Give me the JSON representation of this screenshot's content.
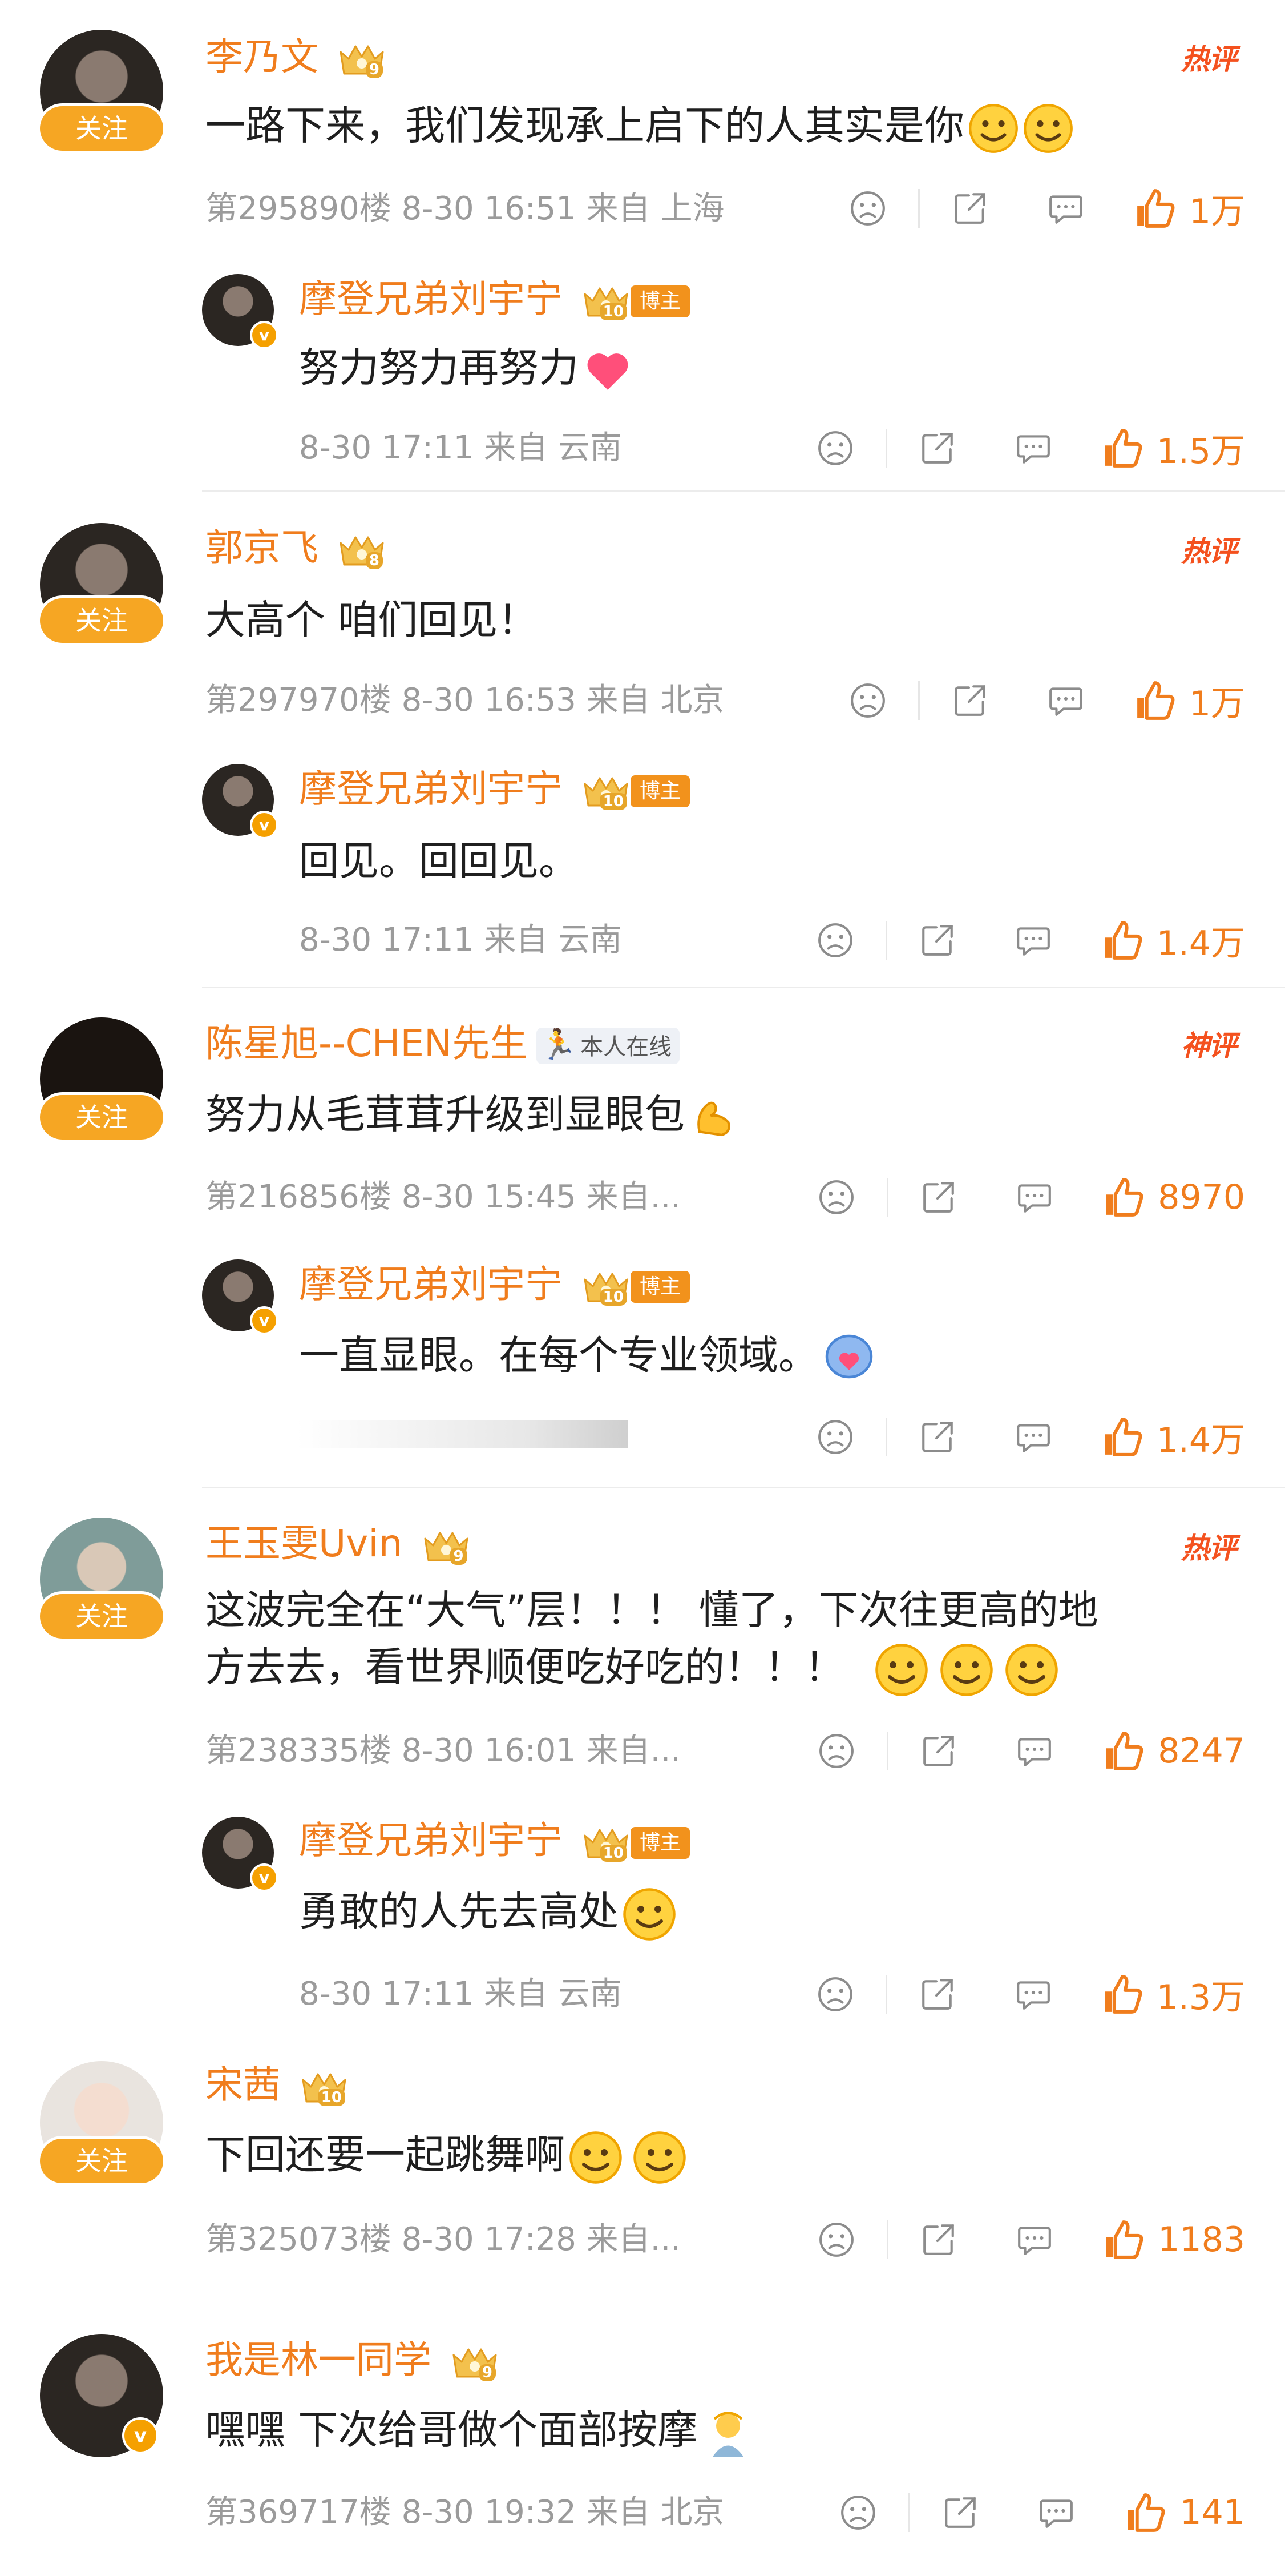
{
  "comments": [
    {
      "name": "李乃文",
      "level": "9",
      "follow_label": "关注",
      "tag": "热评",
      "text": "一路下来，我们发现承上启下的人其实是你",
      "emojis": [
        "smirk-emoji",
        "grin-emoji"
      ],
      "meta": "第295890楼  8-30 16:51  来自 上海",
      "likes": "1万",
      "reply": {
        "name": "摩登兄弟刘宇宁",
        "level": "10",
        "badge": "博主",
        "text": "努力努力再努力",
        "emojis": [
          "heart-emoji"
        ],
        "meta": "8-30 17:11  来自 云南",
        "likes": "1.5万"
      }
    },
    {
      "name": "郭京飞",
      "level": "8",
      "follow_label": "关注",
      "tag": "热评",
      "text": "大高个 咱们回见！",
      "emojis": [],
      "meta": "第297970楼  8-30 16:53  来自 北京",
      "likes": "1万",
      "reply": {
        "name": "摩登兄弟刘宇宁",
        "level": "10",
        "badge": "博主",
        "text": "回见。回回见。",
        "emojis": [],
        "meta": "8-30 17:11  来自 云南",
        "likes": "1.4万"
      }
    },
    {
      "name": "陈星旭--CHEN先生",
      "online_label": "本人在线",
      "follow_label": "关注",
      "tag": "神评",
      "text": "努力从毛茸茸升级到显眼包",
      "emojis": [
        "muscle-emoji"
      ],
      "meta": "第216856楼  8-30 15:45  来自...",
      "likes": "8970",
      "reply": {
        "name": "摩登兄弟刘宇宁",
        "level": "10",
        "badge": "博主",
        "text": "一直显眼。在每个专业领域。",
        "emojis": [
          "heart-bubble-emoji"
        ],
        "meta": "",
        "likes": "1.4万"
      }
    },
    {
      "name": "王玉雯Uvin",
      "level": "9",
      "follow_label": "关注",
      "tag": "热评",
      "text_line1": "这波完全在“大气”层！！！ 懂了，下次往更高的地",
      "text_line2": "方去去，看世界顺便吃好吃的！！！",
      "emojis": [
        "excited-emoji",
        "excited-emoji",
        "excited-emoji"
      ],
      "meta": "第238335楼  8-30 16:01  来自...",
      "likes": "8247",
      "reply": {
        "name": "摩登兄弟刘宇宁",
        "level": "10",
        "badge": "博主",
        "text": "勇敢的人先去高处",
        "emojis": [
          "joy-emoji"
        ],
        "meta": "8-30 17:11  来自 云南",
        "likes": "1.3万"
      }
    },
    {
      "name": "宋茜",
      "level": "10",
      "follow_label": "关注",
      "text": "下回还要一起跳舞啊",
      "emojis": [
        "happy-emoji",
        "happy-emoji"
      ],
      "meta": "第325073楼  8-30 17:28  来自...",
      "likes": "1183"
    },
    {
      "name": "我是林一同学",
      "level": "9",
      "text": "嘿嘿 下次给哥做个面部按摩",
      "emojis": [
        "massage-emoji"
      ],
      "meta": "第369717楼  8-30 19:32  来自 北京",
      "likes": "141"
    }
  ],
  "colors": {
    "accent": "#f07d1d",
    "follow_button": "#f6a623",
    "meta_text": "#9b9b9b",
    "hot_tag": "#f4511e"
  }
}
